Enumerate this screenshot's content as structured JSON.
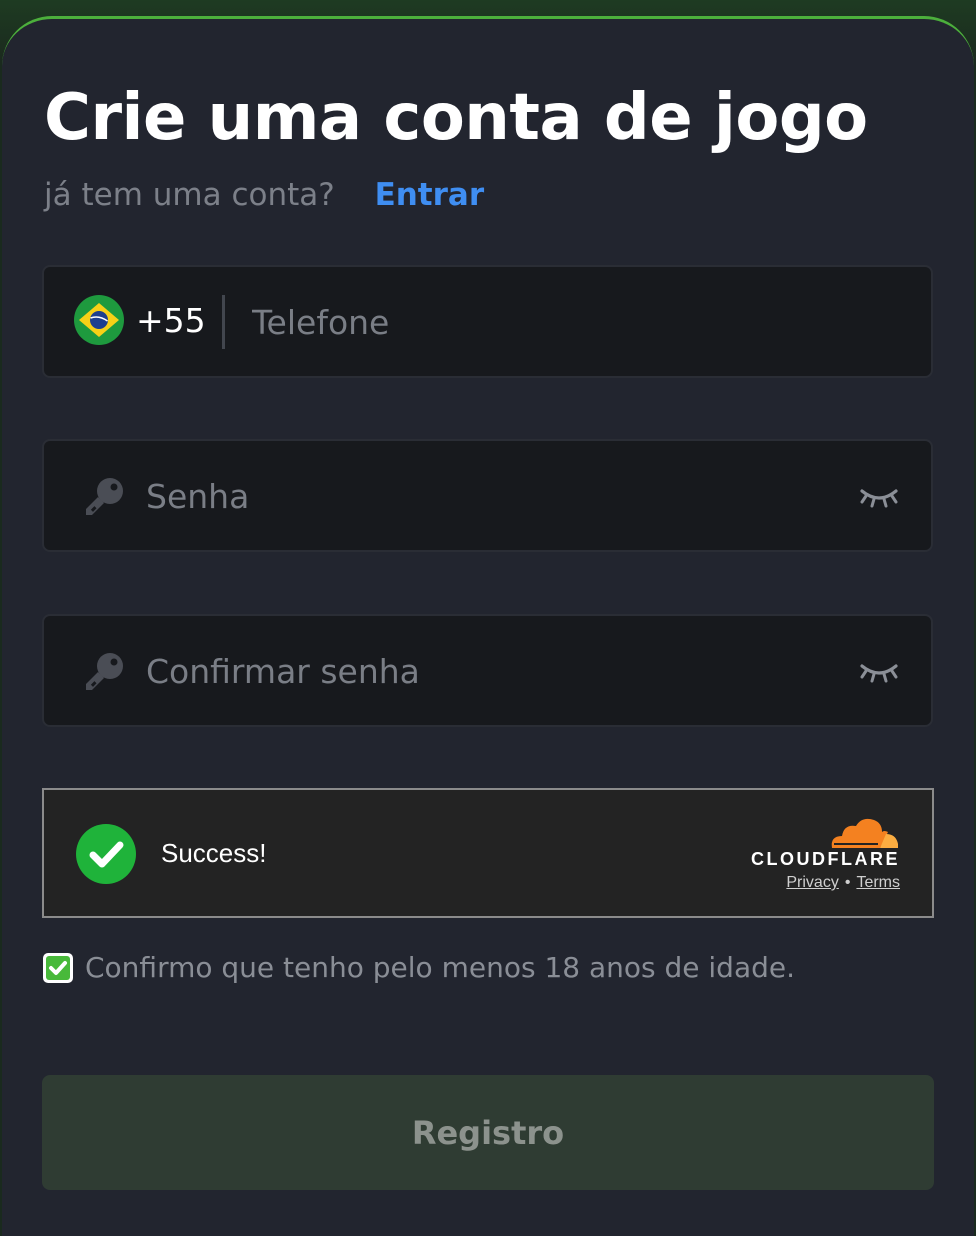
{
  "header": {
    "title": "Crie uma conta de jogo",
    "subtitle": "já tem uma conta?",
    "login_link": "Entrar"
  },
  "form": {
    "phone": {
      "flag_icon": "brazil-flag-icon",
      "dial_code": "+55",
      "placeholder": "Telefone",
      "value": ""
    },
    "password": {
      "icon": "key-icon",
      "placeholder": "Senha",
      "value": "",
      "toggle_icon": "eye-closed-icon"
    },
    "confirm_password": {
      "icon": "key-icon",
      "placeholder": "Confirmar senha",
      "value": "",
      "toggle_icon": "eye-closed-icon"
    },
    "captcha": {
      "status": "Success!",
      "provider": "CLOUDFLARE",
      "privacy": "Privacy",
      "separator": "•",
      "terms": "Terms"
    },
    "age_confirm": {
      "checked": true,
      "label": "Confirmo que tenho pelo menos 18 anos de idade."
    },
    "submit_label": "Registro"
  },
  "colors": {
    "accent_green": "#4caf3c",
    "link_blue": "#3f8ef2",
    "background": "#22252f",
    "field_bg": "#17191d",
    "success_green": "#1fb33a",
    "cloudflare_orange": "#f48120",
    "button_bg": "#2f3c33"
  }
}
